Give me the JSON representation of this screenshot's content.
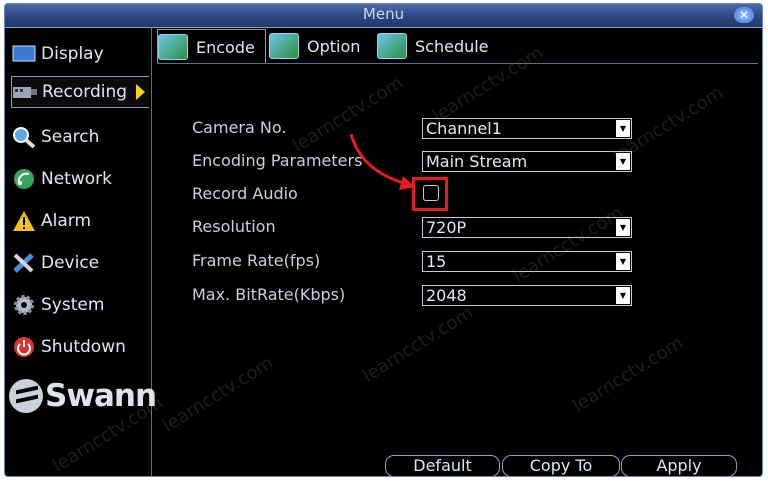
{
  "window": {
    "title": "Menu",
    "close_icon": "close-icon"
  },
  "sidebar": {
    "items": [
      {
        "label": "Display",
        "icon": "display-icon"
      },
      {
        "label": "Recording",
        "icon": "recording-icon",
        "active": true
      },
      {
        "label": "Search",
        "icon": "search-icon"
      },
      {
        "label": "Network",
        "icon": "network-icon"
      },
      {
        "label": "Alarm",
        "icon": "alarm-icon"
      },
      {
        "label": "Device",
        "icon": "device-icon"
      },
      {
        "label": "System",
        "icon": "system-icon"
      },
      {
        "label": "Shutdown",
        "icon": "shutdown-icon"
      }
    ],
    "logo": "Swann"
  },
  "tabs": [
    {
      "label": "Encode",
      "active": true
    },
    {
      "label": "Option"
    },
    {
      "label": "Schedule"
    }
  ],
  "form": {
    "camera_no": {
      "label": "Camera No.",
      "value": "Channel1"
    },
    "encoding_parameters": {
      "label": "Encoding Parameters",
      "value": "Main Stream"
    },
    "record_audio": {
      "label": "Record Audio",
      "checked": false
    },
    "resolution": {
      "label": "Resolution",
      "value": "720P"
    },
    "frame_rate": {
      "label": "Frame Rate(fps)",
      "value": "15"
    },
    "max_bitrate": {
      "label": "Max. BitRate(Kbps)",
      "value": "2048"
    }
  },
  "buttons": {
    "default": "Default",
    "copy_to": "Copy To",
    "apply": "Apply"
  },
  "watermark": "learncctv.com",
  "colors": {
    "highlight": "#e31b23",
    "active_arrow": "#f2d21a",
    "titlebar": "#2b4680"
  }
}
